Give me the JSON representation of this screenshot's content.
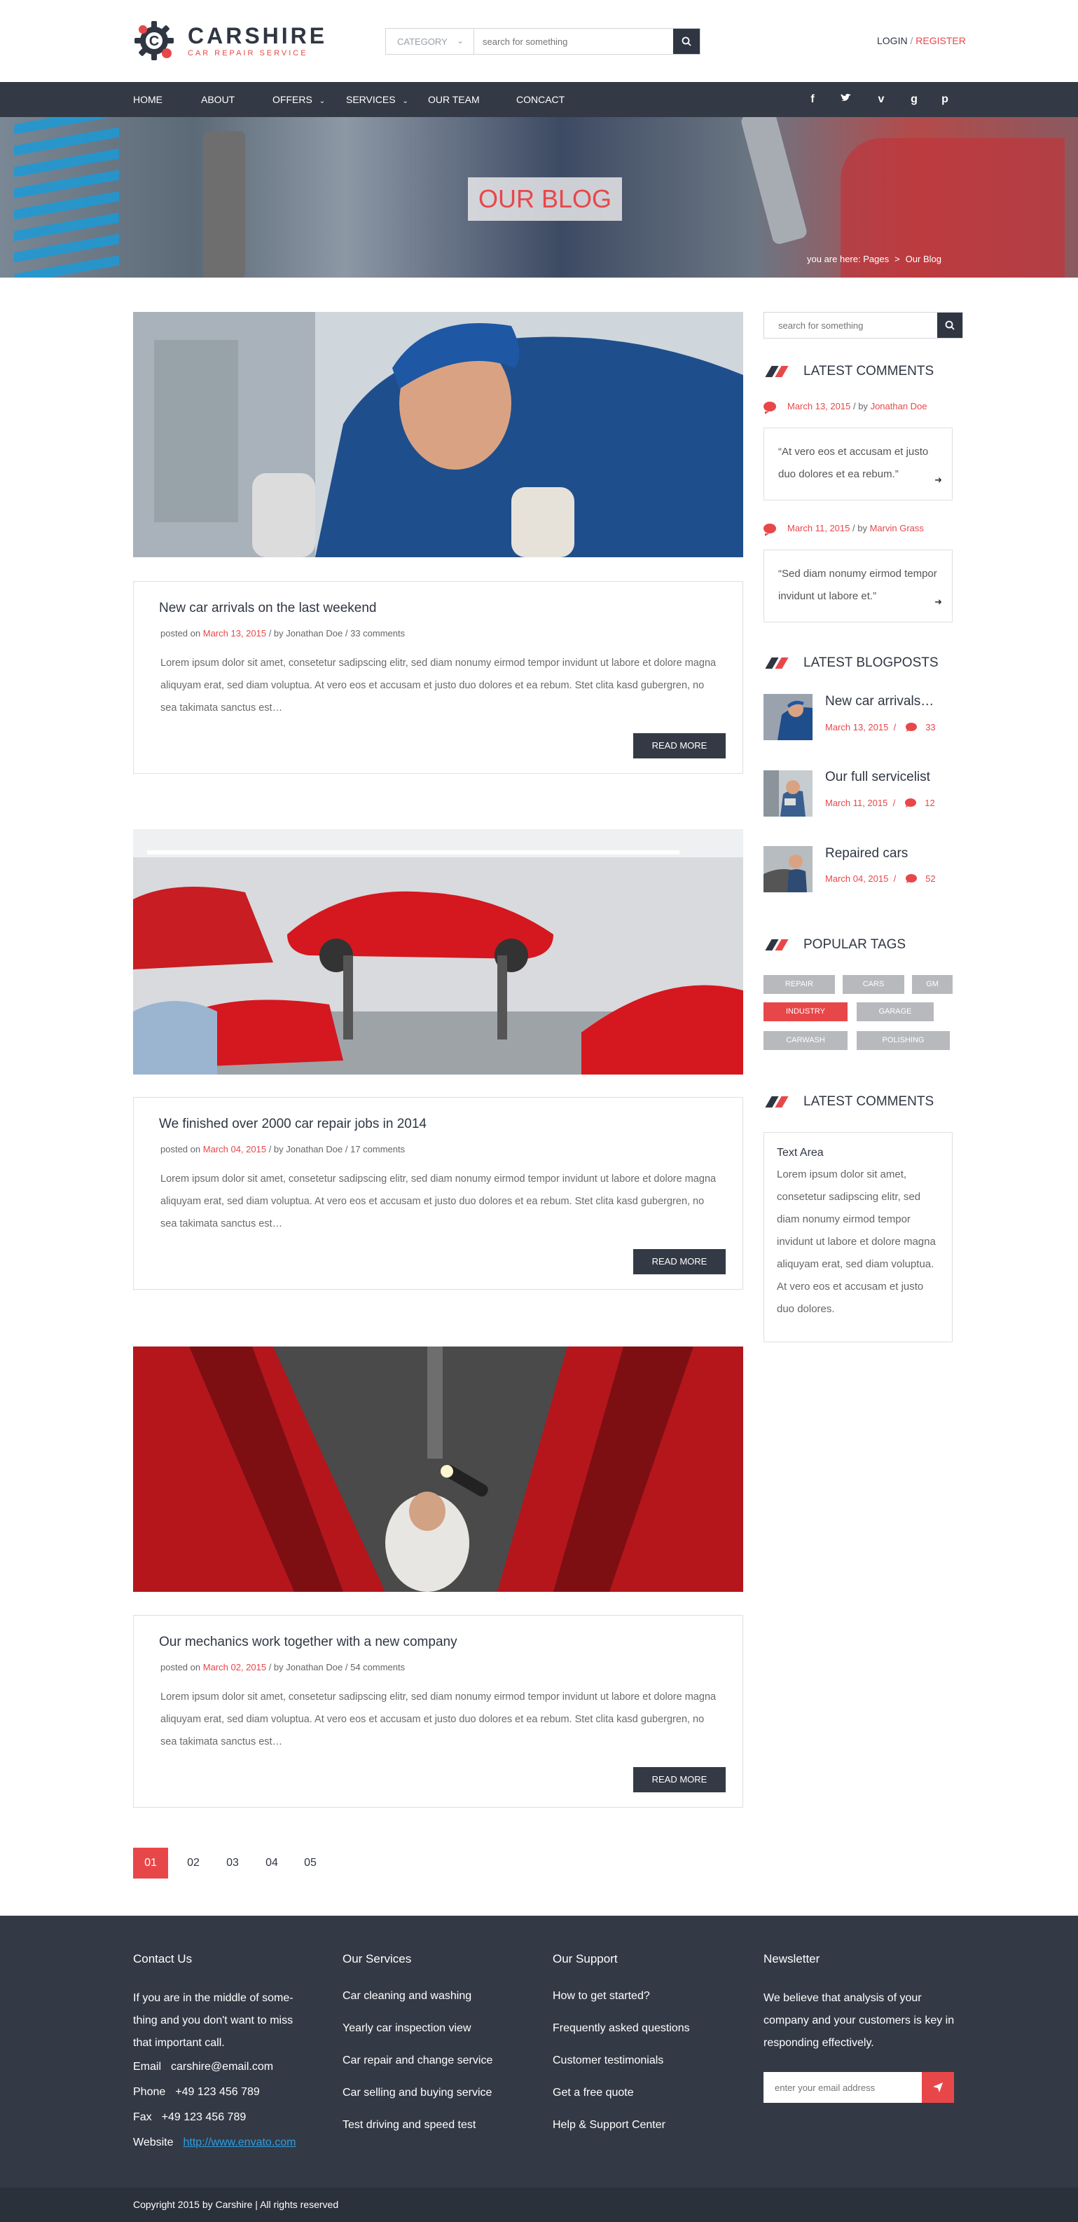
{
  "brand": {
    "name": "CARSHIRE",
    "tagline": "CAR REPAIR SERVICE",
    "logo_letter": "C"
  },
  "header": {
    "category_label": "CATEGORY",
    "search_placeholder": "search for something",
    "login": "LOGIN",
    "login_sep": "/",
    "register": "REGISTER"
  },
  "nav": {
    "items": [
      {
        "label": "HOME"
      },
      {
        "label": "ABOUT"
      },
      {
        "label": "OFFERS"
      },
      {
        "label": "SERVICES"
      },
      {
        "label": "OUR TEAM"
      },
      {
        "label": "CONCACT"
      }
    ],
    "social": [
      "facebook-icon",
      "twitter-icon",
      "vimeo-icon",
      "google-plus-icon",
      "pinterest-icon"
    ]
  },
  "hero": {
    "title": "OUR BLOG",
    "crumb_prefix": "you are here: Pages",
    "crumb_sep": ">",
    "crumb_current": "Our Blog"
  },
  "posts": [
    {
      "title": "New car arrivals on the last weekend",
      "meta_prefix": "posted on",
      "date": "March 13, 2015",
      "author": "/ by Jonathan Doe",
      "comments": "/ 33 comments",
      "excerpt": "Lorem ipsum dolor sit amet, consetetur sadipscing elitr, sed diam nonumy eirmod tempor invidunt ut labore et dolore magna aliquyam erat, sed diam voluptua. At vero eos et accusam et justo duo dolores et ea rebum. Stet clita kasd gubergren, no sea takimata sanctus est…",
      "button": "READ MORE"
    },
    {
      "title": "We finished over 2000 car repair jobs in 2014",
      "meta_prefix": "posted on",
      "date": "March 04, 2015",
      "author": "/ by Jonathan Doe",
      "comments": "/ 17 comments",
      "excerpt": "Lorem ipsum dolor sit amet, consetetur sadipscing elitr, sed diam nonumy eirmod tempor invidunt ut labore et dolore magna aliquyam erat, sed diam voluptua. At vero eos et accusam et justo duo dolores et ea rebum. Stet clita kasd gubergren, no sea takimata sanctus est…",
      "button": "READ MORE"
    },
    {
      "title": "Our mechanics work together with a new company",
      "meta_prefix": "posted on",
      "date": "March 02, 2015",
      "author": "/ by Jonathan Doe",
      "comments": "/ 54 comments",
      "excerpt": "Lorem ipsum dolor sit amet, consetetur sadipscing elitr, sed diam nonumy eirmod tempor invidunt ut labore et dolore magna aliquyam erat, sed diam voluptua. At vero eos et accusam et justo duo dolores et ea rebum. Stet clita kasd gubergren, no sea takimata sanctus est…",
      "button": "READ MORE"
    }
  ],
  "sidebar": {
    "search_placeholder": "search for something",
    "latest_comments_title": "LATEST COMMENTS",
    "comments": [
      {
        "date": "March 13, 2015",
        "by": "/ by",
        "author": "Jonathan Doe",
        "text": "“At vero eos et accusam et justo duo dolores et ea rebum.”"
      },
      {
        "date": "March 11, 2015",
        "by": "/ by",
        "author": "Marvin Grass",
        "text": "“Sed diam nonumy eirmod tempor invidunt ut labore et.”"
      }
    ],
    "latest_posts_title": "LATEST BLOGPOSTS",
    "latest_posts": [
      {
        "title": "New car arrivals…",
        "date": "March 13, 2015",
        "sep": "/",
        "count": "33"
      },
      {
        "title": "Our full servicelist",
        "date": "March 11, 2015",
        "sep": "/",
        "count": "12"
      },
      {
        "title": "Repaired cars",
        "date": "March 04, 2015",
        "sep": "/",
        "count": "52"
      }
    ],
    "tags_title": "POPULAR TAGS",
    "tags": [
      "REPAIR",
      "CARS",
      "GM",
      "INDUSTRY",
      "GARAGE",
      "CARWASH",
      "POLISHING"
    ],
    "text_widget_title": "LATEST COMMENTS",
    "text_area_heading": "Text Area",
    "text_area_body": "Lorem ipsum dolor sit amet, consetetur sadipscing elitr, sed diam nonumy eirmod tempor invidunt ut labore et dolore magna aliquyam erat, sed diam voluptua. At vero eos et accusam et justo duo dolores."
  },
  "pagination": [
    "01",
    "02",
    "03",
    "04",
    "05"
  ],
  "footer": {
    "contact": {
      "title": "Contact Us",
      "intro": "If you are in the middle of some-thing and you don't want to miss that important call.",
      "email_label": "Email",
      "email": "carshire@email.com",
      "phone_label": "Phone",
      "phone": "+49 123 456 789",
      "fax_label": "Fax",
      "fax": "+49 123 456 789",
      "website_label": "Website",
      "website": "http://www.envato.com"
    },
    "services": {
      "title": "Our Services",
      "items": [
        "Car cleaning and washing",
        "Yearly car inspection view",
        "Car repair and change service",
        "Car selling and buying service",
        "Test driving and speed test"
      ]
    },
    "support": {
      "title": "Our Support",
      "items": [
        "How to get started?",
        "Frequently asked questions",
        "Customer testimonials",
        "Get a free quote",
        "Help & Support Center"
      ]
    },
    "newsletter": {
      "title": "Newsletter",
      "text": "We believe that analysis of your company and your customers is key in responding effectively.",
      "placeholder": "enter your email address"
    },
    "copyright": "Copyright 2015 by Carshire | All rights reserved"
  },
  "colors": {
    "accent": "#e8474a",
    "dark": "#333a45",
    "footer": "#333a45",
    "copyright_bar": "#2b313b"
  }
}
